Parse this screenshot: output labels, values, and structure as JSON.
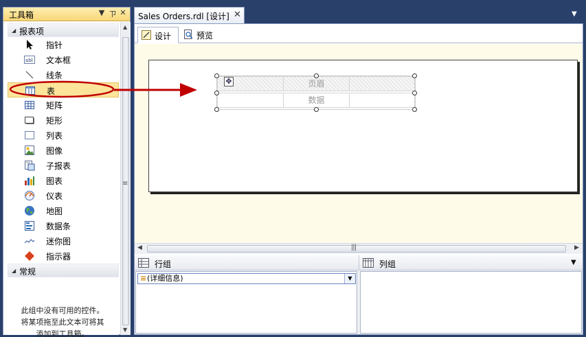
{
  "toolbox": {
    "title": "工具箱",
    "controls": {
      "dropdown": "▼",
      "pin": "ㄗ",
      "close": "✕"
    },
    "sections": {
      "report_items": "报表项",
      "general": "常规"
    },
    "items": [
      {
        "label": "指针",
        "icon": "pointer-icon"
      },
      {
        "label": "文本框",
        "icon": "textbox-icon"
      },
      {
        "label": "线条",
        "icon": "line-icon"
      },
      {
        "label": "表",
        "icon": "table-icon"
      },
      {
        "label": "矩阵",
        "icon": "matrix-icon"
      },
      {
        "label": "矩形",
        "icon": "rectangle-icon"
      },
      {
        "label": "列表",
        "icon": "list-icon"
      },
      {
        "label": "图像",
        "icon": "image-icon"
      },
      {
        "label": "子报表",
        "icon": "subreport-icon"
      },
      {
        "label": "图表",
        "icon": "chart-icon"
      },
      {
        "label": "仪表",
        "icon": "gauge-icon"
      },
      {
        "label": "地图",
        "icon": "map-icon"
      },
      {
        "label": "数据条",
        "icon": "databar-icon"
      },
      {
        "label": "迷你图",
        "icon": "sparkline-icon"
      },
      {
        "label": "指示器",
        "icon": "indicator-icon"
      }
    ],
    "help_text": [
      "此组中没有可用的控件。",
      "将某项拖至此文本可将其",
      "添加到工具箱。"
    ]
  },
  "document": {
    "tab_label": "Sales Orders.rdl [设计]",
    "close": "✕",
    "view_tabs": {
      "design": "设计",
      "preview": "预览"
    },
    "table": {
      "header_cell": "页眉",
      "data_cell": "数据"
    }
  },
  "grouping": {
    "row_groups": "行组",
    "column_groups": "列组",
    "detail_group": "(详细信息)"
  },
  "colors": {
    "accent": "#c00000",
    "selected_item": "#fce49b",
    "canvas_background": "#fffbe9",
    "frame": "#29406b"
  }
}
